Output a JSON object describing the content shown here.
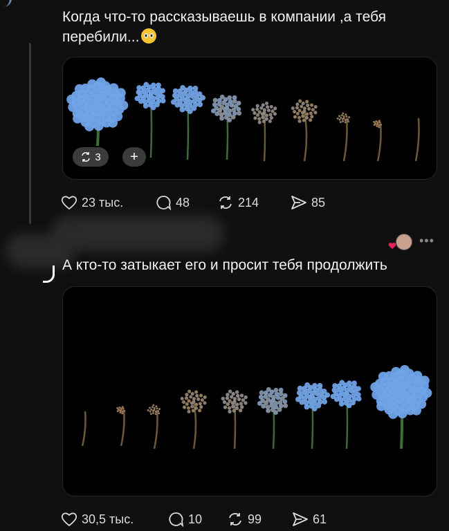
{
  "post1": {
    "text_line1": "Когда что-то рассказываешь в компании ,а тебя",
    "text_line2": "перебили...",
    "emoji": "pleading-face",
    "media": {
      "repost_count": "3",
      "add_label": "+"
    },
    "likes": "23 тыс.",
    "comments": "48",
    "reposts": "214",
    "shares": "85"
  },
  "post2": {
    "text": "А кто-то затыкает его и просит тебя продолжить",
    "more_label": "•••",
    "likes": "30,5 тыс.",
    "comments": "10",
    "reposts": "99",
    "shares": "61"
  },
  "colors": {
    "background": "#101010",
    "text": "#f2f2f2",
    "flower_blue": "#6fa3e8",
    "flower_dry": "#a07a4c"
  }
}
